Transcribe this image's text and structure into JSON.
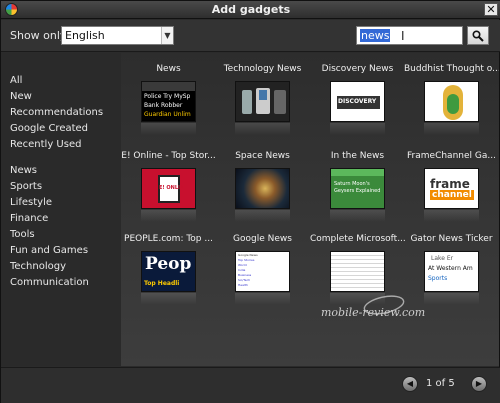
{
  "window": {
    "title": "Add gadgets",
    "close_glyph": "✕"
  },
  "topbar": {
    "show_only_label": "Show only:",
    "language_value": "English",
    "search_value": "news"
  },
  "sidebar": {
    "categories": [
      "All",
      "New",
      "Recommendations",
      "Google Created",
      "Recently Used",
      "News",
      "Sports",
      "Lifestyle",
      "Finance",
      "Tools",
      "Fun and Games",
      "Technology",
      "Communication"
    ]
  },
  "gadgets": [
    {
      "name": "News",
      "thumb_lines": [
        "Police Try MySp",
        "Bank Robber",
        "Guardian Unlim"
      ]
    },
    {
      "name": "Technology News"
    },
    {
      "name": "Discovery News",
      "thumb_text": "DISCOVERY"
    },
    {
      "name": "Buddhist Thought o..."
    },
    {
      "name": "E! Online - Top Stor...",
      "thumb_text": "E! ONLINE"
    },
    {
      "name": "Space News"
    },
    {
      "name": "In the News",
      "thumb_lines": [
        "Saturn Moon's",
        "Geysers Explained"
      ]
    },
    {
      "name": "FrameChannel Ga...",
      "thumb_lines": [
        "frame",
        "channel"
      ]
    },
    {
      "name": "PEOPLE.com: Top ...",
      "thumb_lines": [
        "Peop",
        "Top Headli"
      ]
    },
    {
      "name": "Google News",
      "thumb_lines": [
        "Google News",
        "Top Stories",
        "World",
        "India",
        "Business",
        "Sci/Tech",
        "Health"
      ]
    },
    {
      "name": "Complete Microsoft..."
    },
    {
      "name": "Gator News Ticker",
      "thumb_lines": [
        "Lake Er",
        "At Western Am",
        "Sports"
      ]
    }
  ],
  "footer": {
    "page_indicator": "1 of 5"
  },
  "watermark": {
    "text": "mobile-review.com"
  },
  "colors": {
    "background": "#2b2b2b",
    "text": "#e8e8e8",
    "selection": "#3369d6"
  }
}
